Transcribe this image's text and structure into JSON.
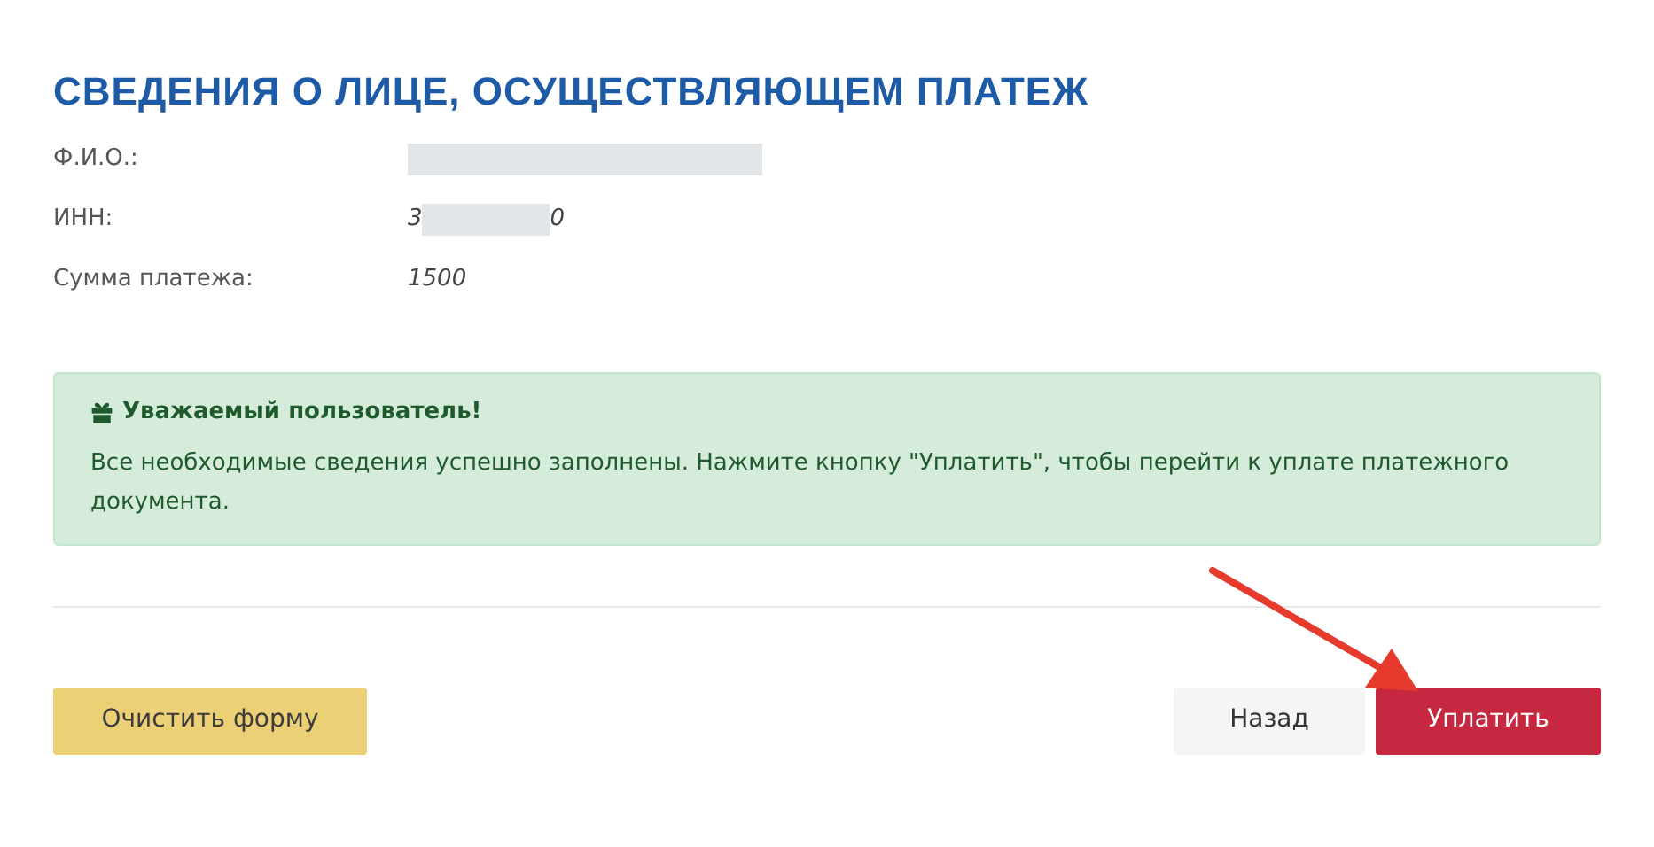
{
  "heading": "СВЕДЕНИЯ О ЛИЦЕ, ОСУЩЕСТВЛЯЮЩЕМ ПЛАТЕЖ",
  "fields": [
    {
      "label": "Ф.И.О.:",
      "redacted": true
    },
    {
      "label": "ИНН:",
      "value_start": "3",
      "value_end": "0",
      "redacted": true
    },
    {
      "label": "Сумма платежа:",
      "value_start": "1500"
    }
  ],
  "alert": {
    "title": "Уважаемый пользователь!",
    "message": "Все необходимые сведения успешно заполнены. Нажмите кнопку \"Уплатить\", чтобы перейти к уплате платежного документа."
  },
  "buttons": [
    {
      "label": "Очистить форму",
      "kind": "warning"
    },
    {
      "label": "Назад",
      "kind": "light"
    },
    {
      "label": "Уплатить",
      "kind": "primary"
    }
  ]
}
